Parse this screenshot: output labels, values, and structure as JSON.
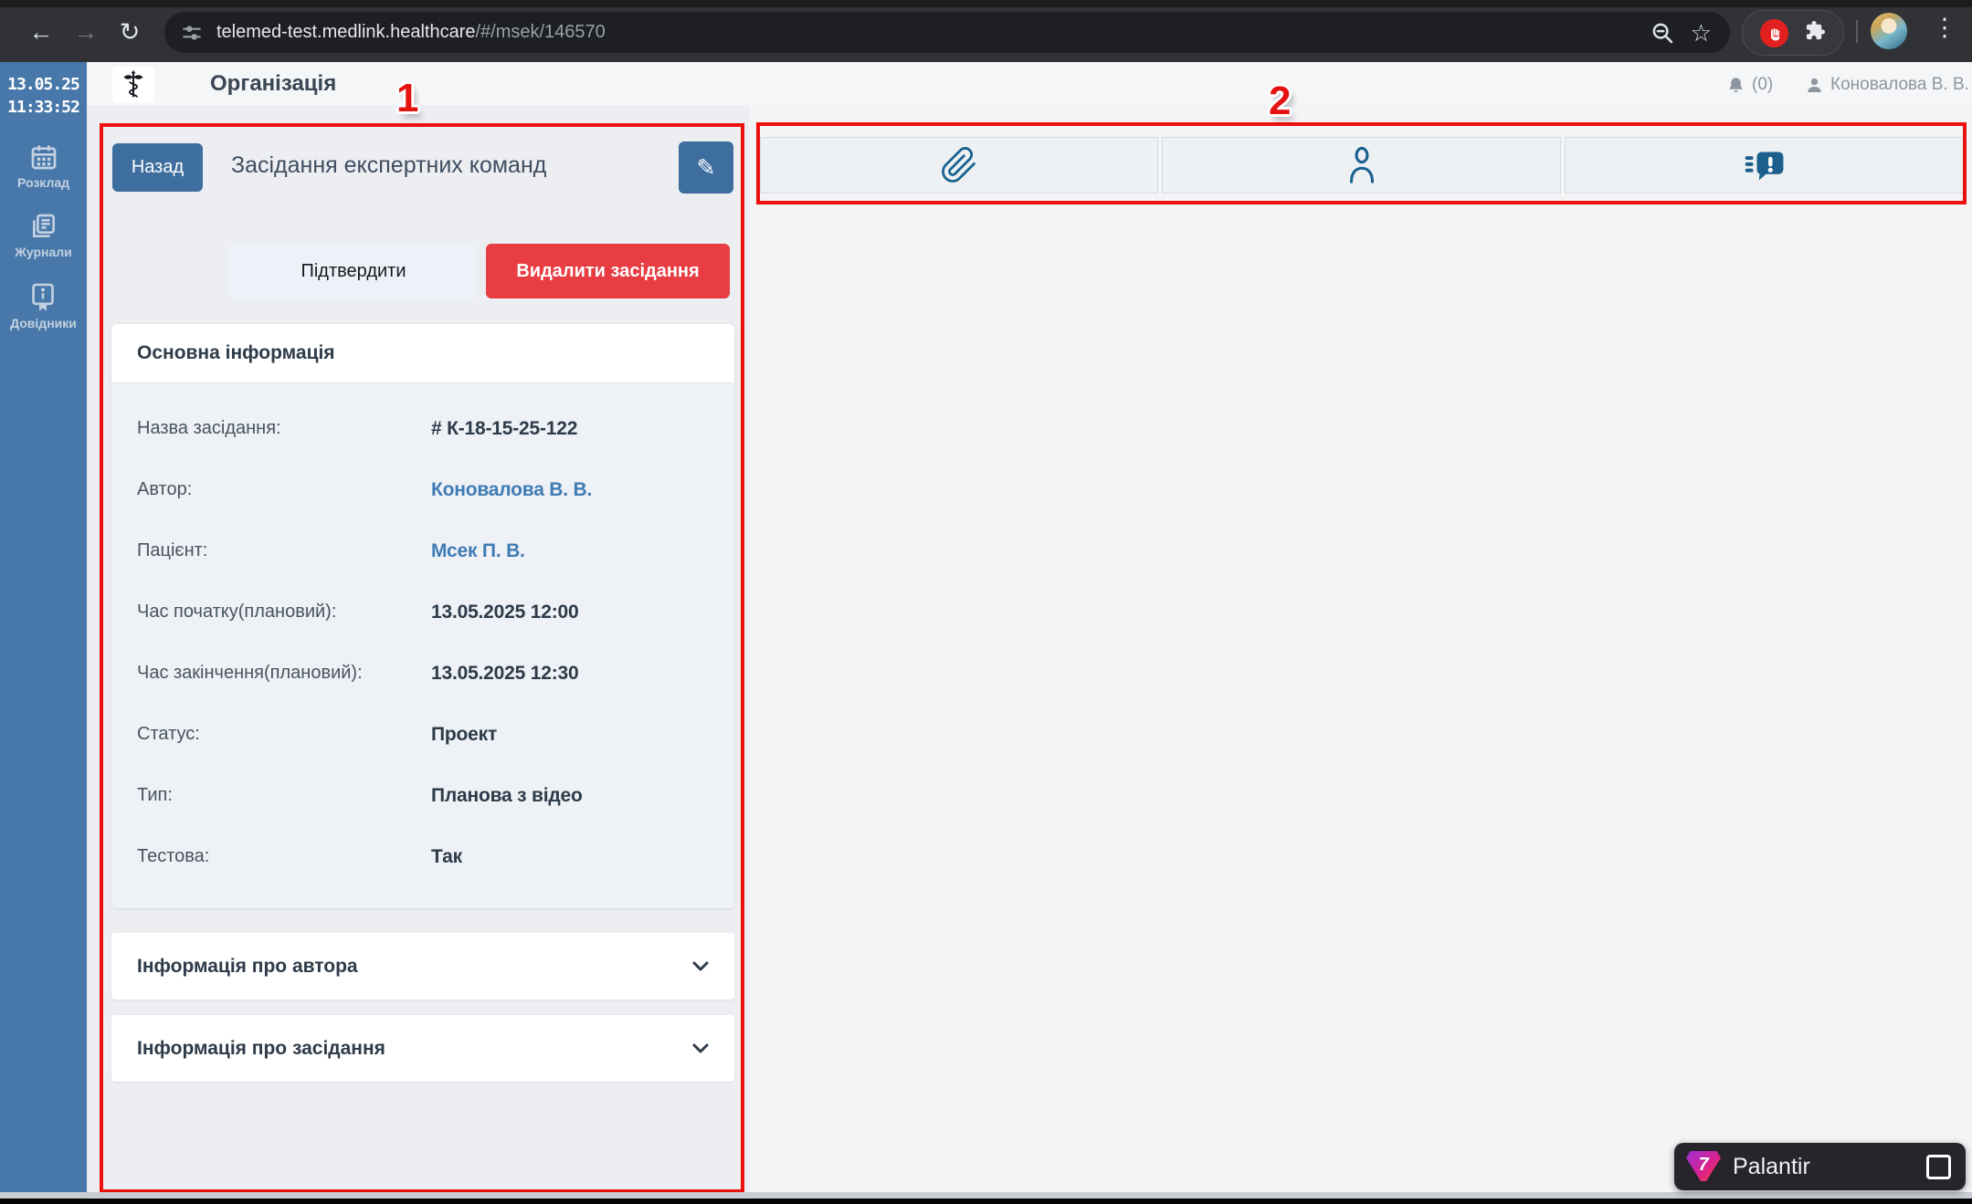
{
  "browser": {
    "url_host": "telemed-test.medlink.healthcare",
    "url_path": "/#/msek/146570"
  },
  "icons": {
    "back": "←",
    "forward": "→",
    "reload": "↻",
    "star": "☆",
    "menu_dots": "⋮",
    "pencil": "✎"
  },
  "sidebar": {
    "date": "13.05.25",
    "time": "11:33:52",
    "items": [
      {
        "icon": "calendar-icon",
        "label": "Розклад"
      },
      {
        "icon": "journals-icon",
        "label": "Журнали"
      },
      {
        "icon": "reference-book-icon",
        "label": "Довідники"
      }
    ]
  },
  "header": {
    "title": "Організація",
    "notifications_count": "(0)",
    "user_name": "Коновалова В. В."
  },
  "meeting": {
    "back": "Назад",
    "title": "Засідання експертних команд",
    "confirm": "Підтвердити",
    "delete": "Видалити засідання",
    "card_title": "Основна інформація",
    "fields": [
      {
        "label": "Назва засідання:",
        "value": "# К-18-15-25-122",
        "kind": "bold"
      },
      {
        "label": "Автор:",
        "value": "Коновалова В. В.",
        "kind": "link"
      },
      {
        "label": "Пацієнт:",
        "value": "Мсек П. В.",
        "kind": "link"
      },
      {
        "label": "Час початку(плановий):",
        "value": "13.05.2025 12:00",
        "kind": "bold"
      },
      {
        "label": "Час закінчення(плановий):",
        "value": "13.05.2025 12:30",
        "kind": "bold"
      },
      {
        "label": "Статус:",
        "value": "Проект",
        "kind": "bold"
      },
      {
        "label": "Тип:",
        "value": "Планова з відео",
        "kind": "bold"
      },
      {
        "label": "Тестова:",
        "value": "Так",
        "kind": "bold"
      }
    ],
    "accordions": [
      {
        "title": "Інформація про автора"
      },
      {
        "title": "Інформація про засідання"
      }
    ]
  },
  "right_tabs": [
    {
      "name": "attachments"
    },
    {
      "name": "participants"
    },
    {
      "name": "messages"
    }
  ],
  "annotations": {
    "box1_label": "1",
    "box2_label": "2"
  },
  "widget": {
    "name": "Palantir"
  },
  "colors": {
    "sidebar_blue": "#4778a9",
    "accent_blue": "#3d6e9e",
    "danger_red": "#e73d43",
    "link_blue": "#3e7cb5",
    "icon_blue": "#19618f",
    "annotation_red": "#ee100d"
  }
}
